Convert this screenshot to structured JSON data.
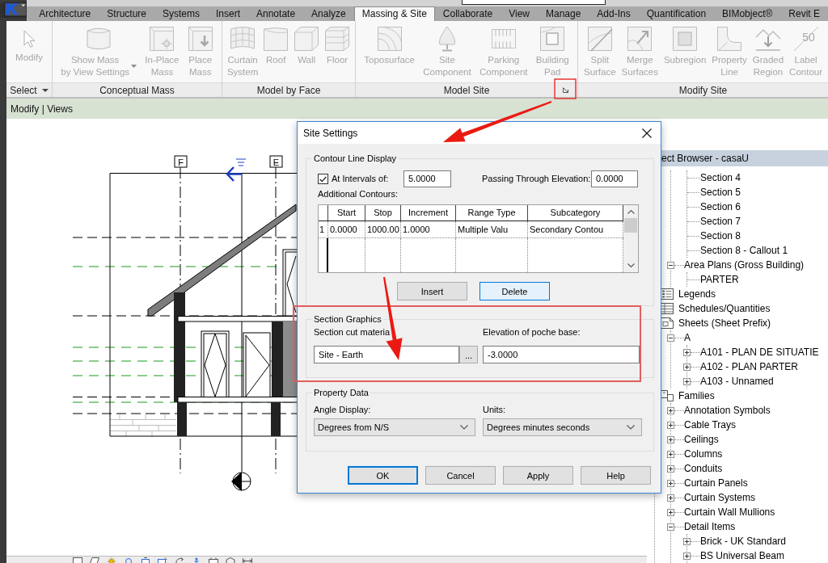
{
  "ribbon": {
    "tabs": [
      {
        "label": "Architecture",
        "selected": false
      },
      {
        "label": "Structure",
        "selected": false
      },
      {
        "label": "Systems",
        "selected": false
      },
      {
        "label": "Insert",
        "selected": false
      },
      {
        "label": "Annotate",
        "selected": false
      },
      {
        "label": "Analyze",
        "selected": false
      },
      {
        "label": "Massing & Site",
        "selected": true
      },
      {
        "label": "Collaborate",
        "selected": false
      },
      {
        "label": "View",
        "selected": false
      },
      {
        "label": "Manage",
        "selected": false
      },
      {
        "label": "Add-Ins",
        "selected": false
      },
      {
        "label": "Quantification",
        "selected": false
      },
      {
        "label": "BIMobject®",
        "selected": false
      },
      {
        "label": "Revit E",
        "selected": false
      }
    ],
    "panels": [
      {
        "title": "Select",
        "dropdown": true,
        "buttons": [
          {
            "label": "Modify",
            "disabled": true
          }
        ]
      },
      {
        "title": "Conceptual Mass",
        "buttons": [
          {
            "label": "Show Mass\nby View Settings",
            "disabled": true,
            "dropdown": true
          },
          {
            "label": "In-Place\nMass",
            "disabled": true
          },
          {
            "label": "Place\nMass",
            "disabled": true
          }
        ]
      },
      {
        "title": "Model by Face",
        "buttons": [
          {
            "label": "Curtain\nSystem",
            "disabled": true
          },
          {
            "label": "Roof",
            "disabled": true
          },
          {
            "label": "Wall",
            "disabled": true
          },
          {
            "label": "Floor",
            "disabled": true
          }
        ]
      },
      {
        "title": "Model Site",
        "launcher": true,
        "buttons": [
          {
            "label": "Toposurface",
            "disabled": true
          },
          {
            "label": "Site\nComponent",
            "disabled": true
          },
          {
            "label": "Parking\nComponent",
            "disabled": true
          },
          {
            "label": "Building\nPad",
            "disabled": true
          }
        ]
      },
      {
        "title": "Modify Site",
        "buttons": [
          {
            "label": "Split\nSurface",
            "disabled": true
          },
          {
            "label": "Merge\nSurfaces",
            "disabled": true
          },
          {
            "label": "Subregion",
            "disabled": true
          },
          {
            "label": "Property\nLine",
            "disabled": true
          },
          {
            "label": "Graded\nRegion",
            "disabled": true
          },
          {
            "label": "Label\nContour",
            "icon_text": "50",
            "disabled": true
          }
        ]
      }
    ]
  },
  "context_tab": {
    "label": "Modify | Views"
  },
  "canvas": {
    "grid_labels": [
      "F",
      "E"
    ]
  },
  "project_browser": {
    "title": "ect Browser - casaU",
    "tree": [
      {
        "children": [
          {
            "children": [
              {
                "label": "Section 4"
              },
              {
                "label": "Section 5"
              },
              {
                "label": "Section 6"
              },
              {
                "label": "Section 7"
              },
              {
                "label": "Section 8"
              },
              {
                "label": "Section 8 - Callout 1"
              }
            ]
          },
          {
            "label": "Area Plans (Gross Building)",
            "expanded": true,
            "children": [
              {
                "label": "PARTER"
              }
            ]
          }
        ]
      },
      {
        "label": "Legends",
        "kind": "legend"
      },
      {
        "label": "Schedules/Quantities",
        "kind": "schedule"
      },
      {
        "label": "Sheets (Sheet Prefix)",
        "kind": "sheet",
        "children": [
          {
            "label": "A",
            "expanded": true,
            "children": [
              {
                "label": "A101 - PLAN DE SITUATIE",
                "expanded": false
              },
              {
                "label": "A102 - PLAN PARTER",
                "expanded": false
              },
              {
                "label": "A103 - Unnamed",
                "expanded": false
              }
            ]
          }
        ]
      },
      {
        "label": "Families",
        "kind": "family",
        "children": [
          {
            "label": "Annotation Symbols",
            "expanded": false
          },
          {
            "label": "Cable Trays",
            "expanded": false
          },
          {
            "label": "Ceilings",
            "expanded": false
          },
          {
            "label": "Columns",
            "expanded": false
          },
          {
            "label": "Conduits",
            "expanded": false
          },
          {
            "label": "Curtain Panels",
            "expanded": false
          },
          {
            "label": "Curtain Systems",
            "expanded": false
          },
          {
            "label": "Curtain Wall Mullions",
            "expanded": false
          },
          {
            "label": "Detail Items",
            "expanded": true,
            "children": [
              {
                "label": "Brick - UK Standard",
                "expanded": false
              },
              {
                "label": "BS Universal Beam",
                "expanded": false
              }
            ]
          }
        ]
      }
    ]
  },
  "dialog": {
    "title": "Site Settings",
    "contour_group": {
      "title": "Contour Line Display",
      "intervals": {
        "label": "At Intervals of:",
        "checked": true,
        "value": "5.0000"
      },
      "passing": {
        "label": "Passing Through Elevation:",
        "value": "0.0000"
      },
      "additional_label": "Additional Contours:",
      "table": {
        "columns": [
          "Start",
          "Stop",
          "Increment",
          "Range Type",
          "Subcategory"
        ],
        "rows": [
          {
            "number": "1",
            "cells": [
              "0.0000",
              "1000.00",
              "1.0000",
              "Multiple Valu",
              "Secondary Contou"
            ]
          }
        ]
      },
      "buttons": [
        {
          "label": "Insert",
          "focused": false
        },
        {
          "label": "Delete",
          "focused": true
        }
      ]
    },
    "section_group": {
      "title": "Section Graphics",
      "material": {
        "label": "Section cut materia",
        "value": "Site - Earth",
        "browse": "..."
      },
      "poche": {
        "label": "Elevation of poche base:",
        "value": "-3.0000"
      }
    },
    "property_group": {
      "title": "Property Data",
      "angle": {
        "label": "Angle Display:",
        "value": "Degrees from N/S"
      },
      "units": {
        "label": "Units:",
        "value": "Degrees minutes seconds"
      }
    },
    "buttons": [
      {
        "label": "OK",
        "default": true
      },
      {
        "label": "Cancel",
        "default": false
      },
      {
        "label": "Apply",
        "default": false
      },
      {
        "label": "Help",
        "default": false
      }
    ]
  }
}
